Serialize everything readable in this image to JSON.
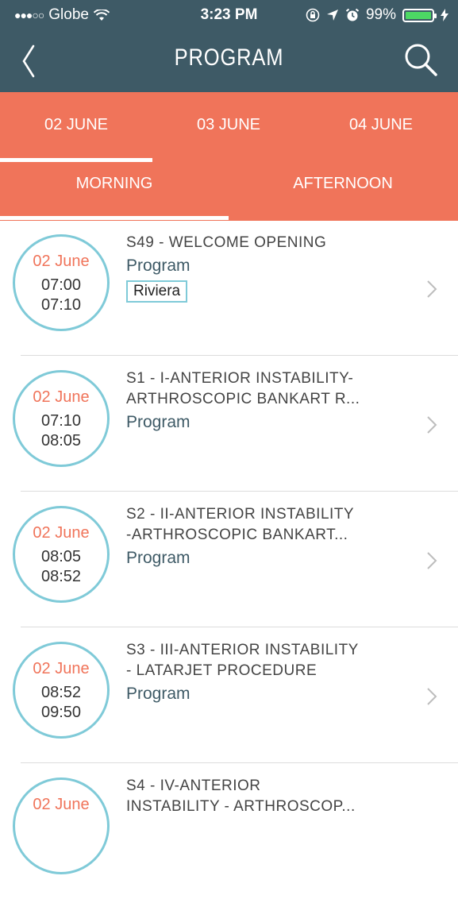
{
  "status_bar": {
    "signal": "●●●○○",
    "carrier": "Globe",
    "time": "3:23 PM",
    "battery": "99%",
    "battery_level": 0.99
  },
  "nav": {
    "title": "PROGRAM",
    "back_icon": "chevron-left-icon",
    "search_icon": "search-icon"
  },
  "date_tabs": [
    {
      "label": "02 JUNE",
      "selected": true
    },
    {
      "label": "03 JUNE",
      "selected": false
    },
    {
      "label": "04 JUNE",
      "selected": false
    }
  ],
  "period_tabs": [
    {
      "label": "MORNING",
      "selected": true
    },
    {
      "label": "AFTERNOON",
      "selected": false
    }
  ],
  "sessions": [
    {
      "date": "02 June",
      "start": "07:00",
      "end": "07:10",
      "title": "S49 - WELCOME OPENING",
      "category": "Program",
      "room": "Riviera"
    },
    {
      "date": "02 June",
      "start": "07:10",
      "end": "08:05",
      "title": "S1 - I-ANTERIOR INSTABILITY-\nARTHROSCOPIC BANKART R...",
      "category": "Program"
    },
    {
      "date": "02 June",
      "start": "08:05",
      "end": "08:52",
      "title": "S2 - II-ANTERIOR INSTABILITY\n-ARTHROSCOPIC BANKART...",
      "category": "Program"
    },
    {
      "date": "02 June",
      "start": "08:52",
      "end": "09:50",
      "title": "S3 - III-ANTERIOR INSTABILITY\n- LATARJET PROCEDURE",
      "category": "Program"
    },
    {
      "date": "02 June",
      "title": "S4 - IV-ANTERIOR\nINSTABILITY - ARTHROSCOP..."
    }
  ],
  "colors": {
    "header": "#3e5a66",
    "accent": "#f0745a",
    "circle": "#7fcad8"
  }
}
